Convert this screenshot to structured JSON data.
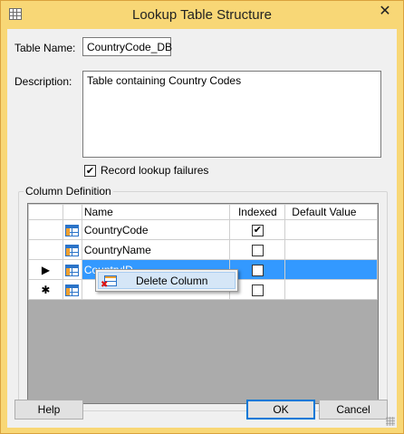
{
  "window": {
    "title": "Lookup Table Structure",
    "close_glyph": "✕",
    "icon": "grid-icon"
  },
  "form": {
    "table_name_label": "Table Name:",
    "table_name_value": "CountryCode_DB",
    "description_label": "Description:",
    "description_value": "Table containing Country Codes",
    "record_failures_label": "Record lookup failures",
    "record_failures_checked": true
  },
  "column_definition": {
    "group_title": "Column Definition",
    "headers": {
      "name": "Name",
      "indexed": "Indexed",
      "default": "Default Value"
    },
    "rows": [
      {
        "row_marker": "",
        "name": "CountryCode",
        "indexed": true,
        "default": ""
      },
      {
        "row_marker": "",
        "name": "CountryName",
        "indexed": false,
        "default": ""
      },
      {
        "row_marker": "▶",
        "name": "CountryID",
        "indexed": false,
        "default": "",
        "selected": true
      },
      {
        "row_marker": "✱",
        "name": "",
        "indexed": false,
        "default": ""
      }
    ]
  },
  "context_menu": {
    "items": [
      {
        "label": "Delete Column",
        "icon": "delete-column-icon"
      }
    ]
  },
  "buttons": {
    "help": "Help",
    "ok": "OK",
    "cancel": "Cancel"
  },
  "colors": {
    "title_bar": "#f8d776",
    "selection": "#3399ff",
    "client_bg": "#f0f0f0",
    "grid_bg": "#ababab"
  },
  "check_glyph": "✔"
}
